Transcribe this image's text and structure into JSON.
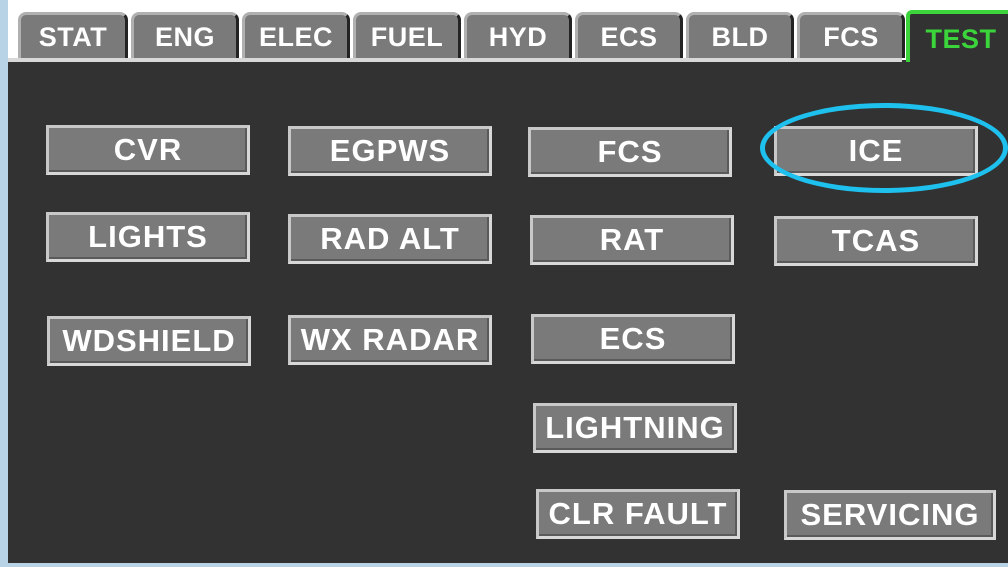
{
  "tabs": {
    "stat": "STAT",
    "eng": "ENG",
    "elec": "ELEC",
    "fuel": "FUEL",
    "hyd": "HYD",
    "ecs": "ECS",
    "bld": "BLD",
    "fcs": "FCS",
    "test": "TEST"
  },
  "active_tab": "TEST",
  "tests": {
    "cvr": "CVR",
    "egpws": "EGPWS",
    "fcs": "FCS",
    "ice": "ICE",
    "lights": "LIGHTS",
    "rad_alt": "RAD ALT",
    "rat": "RAT",
    "tcas": "TCAS",
    "wdshield": "WDSHIELD",
    "wx_radar": "WX RADAR",
    "ecs": "ECS",
    "lightning": "LIGHTNING",
    "clr_fault": "CLR FAULT",
    "servicing": "SERVICING"
  },
  "colors": {
    "background": "#323232",
    "button": "#7a7a7a",
    "active_tab": "#3bd43b",
    "highlight": "#1ec0ee",
    "frame": "#b9d3e6"
  }
}
